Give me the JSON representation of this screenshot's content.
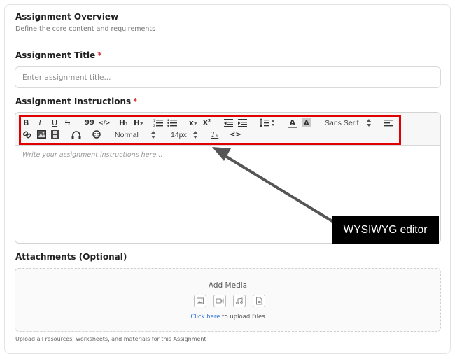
{
  "overview": {
    "title": "Assignment Overview",
    "subtitle": "Define the core content and requirements"
  },
  "title_field": {
    "label": "Assignment Title",
    "required_mark": "*",
    "placeholder": "Enter assignment title...",
    "value": ""
  },
  "instructions": {
    "label": "Assignment Instructions",
    "required_mark": "*",
    "placeholder": "Write your assignment instructions here...",
    "toolbar": {
      "bold": "B",
      "italic": "I",
      "underline": "U",
      "strike": "S",
      "blockquote": "99",
      "code": "</>",
      "h1": "H₁",
      "h2": "H₂",
      "subscript": "x₂",
      "superscript": "x²",
      "font_family": "Sans Serif",
      "header_select": "Normal",
      "size_select": "14px",
      "clear_format": "Tₓ",
      "source": "<>"
    }
  },
  "annotation": {
    "callout_text": "WYSIWYG editor",
    "highlight_color": "#e00000",
    "arrow_color": "#555555"
  },
  "attachments": {
    "label": "Attachments (Optional)",
    "add_media": "Add Media",
    "click_here": "Click here",
    "upload_suffix": " to upload Files",
    "footnote": "Upload all resources, worksheets, and materials for this Assignment",
    "media_icons": [
      "image-icon",
      "video-icon",
      "audio-icon",
      "document-icon"
    ]
  }
}
